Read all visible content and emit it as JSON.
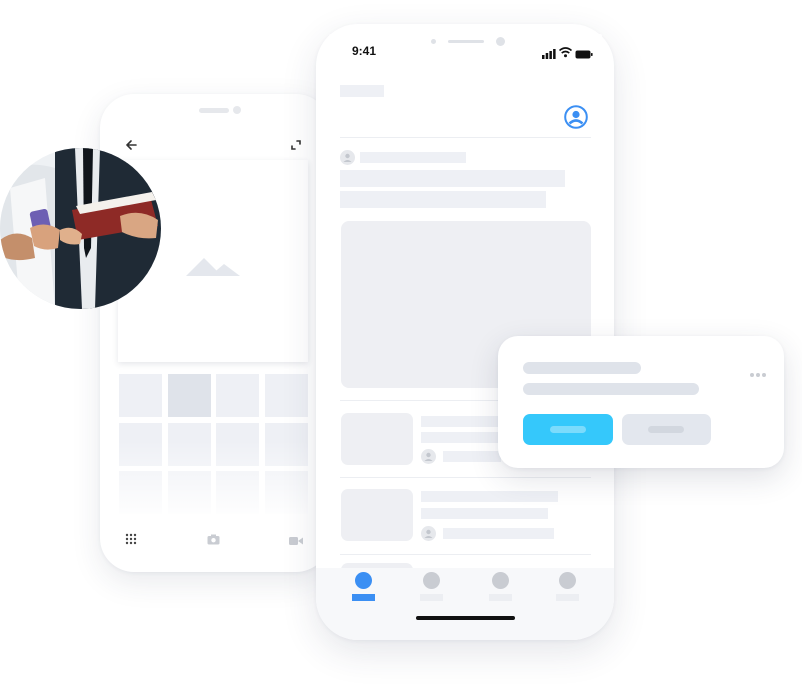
{
  "status_bar": {
    "time": "9:41"
  },
  "colors": {
    "accent": "#3b8ff3",
    "cyan_button": "#35c8fb",
    "skeleton": "#eef0f5",
    "skeleton_dark": "#dfe3ea",
    "inactive_tab": "#c9ccd2"
  },
  "icons": {
    "back": "arrow-left-icon",
    "expand": "expand-icon",
    "grid": "grid-icon",
    "camera": "camera-icon",
    "video": "video-icon",
    "profile": "user-circle-icon",
    "more": "more-dots-icon",
    "image_placeholder": "mountain-image-icon"
  },
  "tabs": [
    {
      "state": "active"
    },
    {
      "state": "inactive"
    },
    {
      "state": "inactive"
    },
    {
      "state": "inactive"
    }
  ]
}
